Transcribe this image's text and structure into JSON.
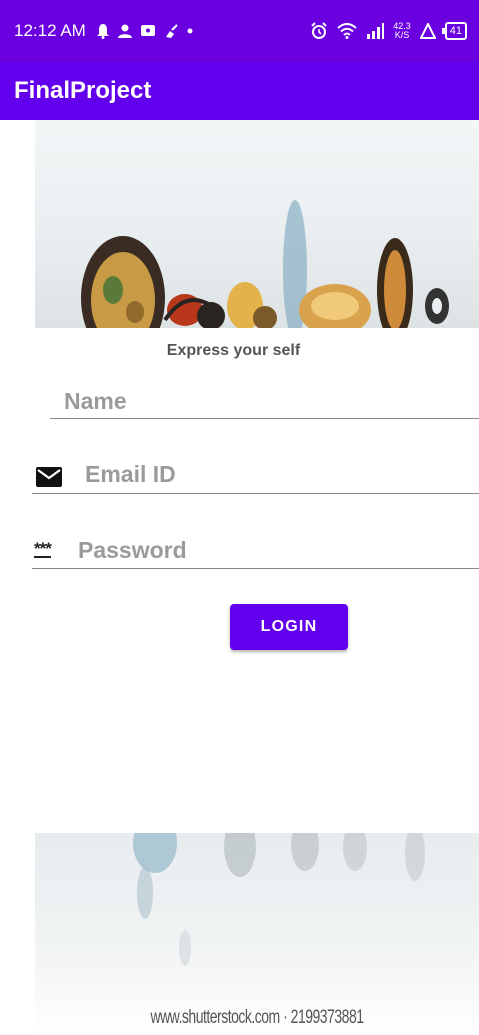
{
  "status_bar": {
    "time": "12:12 AM",
    "left_icons": [
      "notification-bell-icon",
      "person-icon",
      "message-icon",
      "clean-icon",
      "dot-icon"
    ],
    "network_speed_top": "42.3",
    "network_speed_bottom": "K/S",
    "battery_level": "41"
  },
  "app_bar": {
    "title": "FinalProject"
  },
  "form": {
    "tagline": "Express your self",
    "name_placeholder": "Name",
    "email_placeholder": "Email ID",
    "password_placeholder": "Password",
    "password_icon_text": "***",
    "login_label": "LOGIN"
  },
  "footer": {
    "watermark": "www.shutterstock.com · 2199373881"
  },
  "colors": {
    "primary": "#6200ee",
    "status_bar": "#6a00e0"
  }
}
